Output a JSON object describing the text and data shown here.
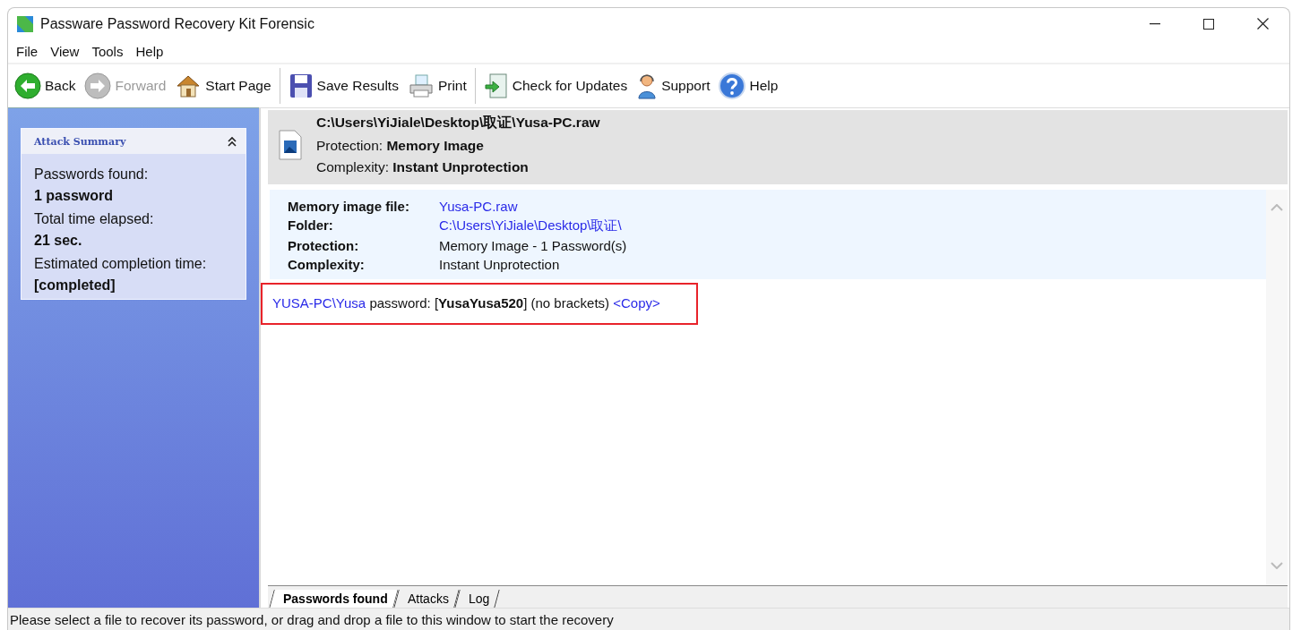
{
  "window": {
    "title": "Passware Password Recovery Kit Forensic"
  },
  "menu": [
    "File",
    "View",
    "Tools",
    "Help"
  ],
  "toolbar": [
    [
      {
        "kind": "back",
        "label": "Back",
        "disabled": false
      },
      {
        "kind": "forward",
        "label": "Forward",
        "disabled": true
      },
      {
        "kind": "home",
        "label": "Start Page",
        "disabled": false
      }
    ],
    [
      {
        "kind": "save",
        "label": "Save Results",
        "disabled": false
      },
      {
        "kind": "print",
        "label": "Print",
        "disabled": false
      }
    ],
    [
      {
        "kind": "update",
        "label": "Check for Updates",
        "disabled": false
      },
      {
        "kind": "support",
        "label": "Support",
        "disabled": false
      },
      {
        "kind": "help",
        "label": "Help",
        "disabled": false
      }
    ]
  ],
  "attack_summary": {
    "title": "Attack Summary",
    "expanded": true,
    "entries": [
      {
        "label": "Passwords found:",
        "value": "1 password"
      },
      {
        "label": "Total time elapsed:",
        "value": "21 sec."
      },
      {
        "label": "Estimated completion time:",
        "value": "[completed]"
      }
    ]
  },
  "file_header": {
    "path": "C:\\Users\\YiJiale\\Desktop\\取证\\Yusa-PC.raw",
    "protection_label": "Protection:",
    "protection_value": "Memory Image",
    "complexity_label": "Complexity:",
    "complexity_value": "Instant Unprotection"
  },
  "details": [
    {
      "label": "Memory image file:",
      "value": "Yusa-PC.raw",
      "kind": "link"
    },
    {
      "label": "Folder:",
      "value": "C:\\Users\\YiJiale\\Desktop\\取证\\",
      "kind": "link"
    },
    {
      "label": "Protection:",
      "value": "Memory Image - 1 Password(s)",
      "kind": "text"
    },
    {
      "label": "Complexity:",
      "value": "Instant Unprotection",
      "kind": "text"
    }
  ],
  "result": {
    "account": "YUSA-PC\\Yusa",
    "sentence": "password: [**YusaYusa520**] (no brackets)",
    "copy_link": "<Copy>",
    "highlighted": true
  },
  "tabs": [
    {
      "label": "Passwords found",
      "selected": true
    },
    {
      "label": "Attacks",
      "selected": false
    },
    {
      "label": "Log",
      "selected": false
    }
  ],
  "status_bar": "Please select a file to recover its password, or drag and drop a file to this window to start the recovery"
}
